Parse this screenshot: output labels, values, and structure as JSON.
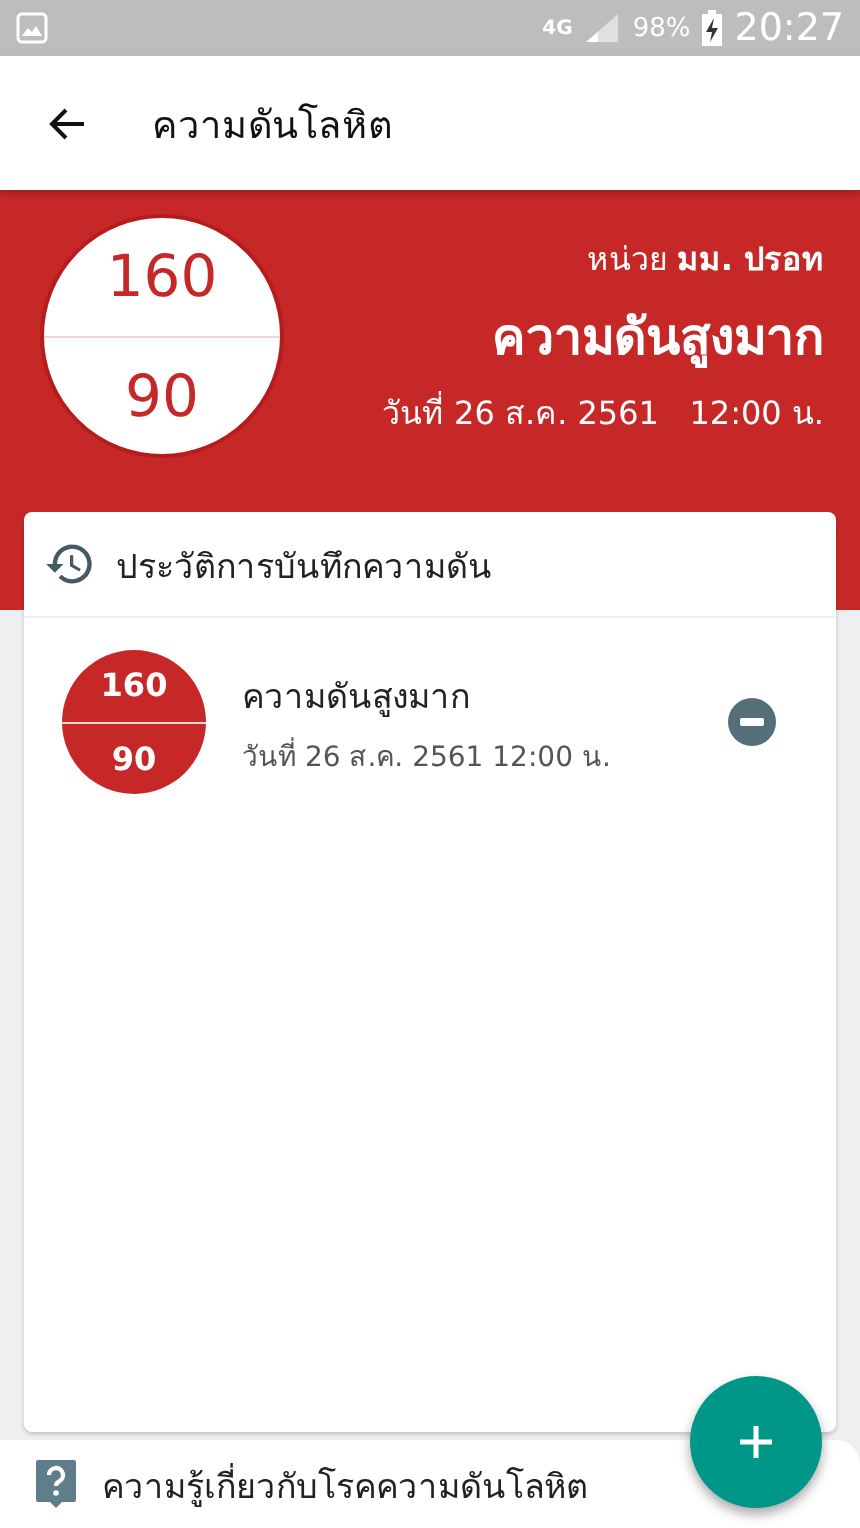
{
  "status_bar": {
    "network": "4G",
    "battery": "98%",
    "time": "20:27"
  },
  "app_bar": {
    "title": "ความดันโลหิต"
  },
  "summary": {
    "systolic": "160",
    "diastolic": "90",
    "unit": "หน่วย **มม. ปรอท**",
    "status": "ความดันสูงมาก",
    "date": "วันที่ 26 ส.ค. 2561   12:00 น."
  },
  "history": {
    "title": "ประวัติการบันทึกความดัน",
    "records": [
      {
        "systolic": "160",
        "diastolic": "90",
        "status": "ความดันสูงมาก",
        "date": "วันที่ 26 ส.ค. 2561 12:00 น.",
        "color": "#c62828"
      }
    ]
  },
  "bottom_link": {
    "label": "ความรู้เกี่ยวกับโรคความดันโลหิต"
  }
}
